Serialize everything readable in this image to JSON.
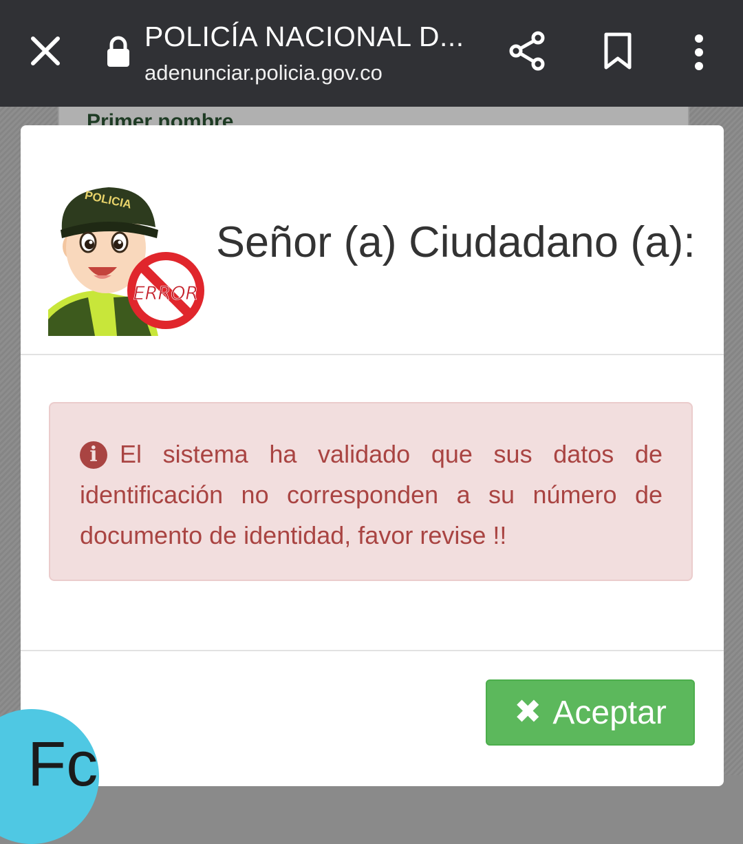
{
  "browser": {
    "title": "POLICÍA NACIONAL D...",
    "url": "adenunciar.policia.gov.co"
  },
  "background_page": {
    "field_label": "Primer nombre"
  },
  "modal": {
    "avatar_cap_text": "POLICIA",
    "avatar_badge_text": "ERROR",
    "title": "Señor (a) Ciudadano (a):",
    "alert_message": "El sistema ha validado que sus datos de identificación no corresponden a su número de documento de identidad, favor revise !!",
    "accept_label": "Aceptar"
  },
  "floating_button": {
    "text": "Fc"
  },
  "icons": [
    "close-icon",
    "lock-icon",
    "share-icon",
    "bookmark-icon",
    "more-vert-icon",
    "info-circle-icon",
    "times-icon"
  ],
  "colors": {
    "toolbar": "#303135",
    "alert_background": "#f2dede",
    "alert_text": "#a94442",
    "accept_button": "#5cb85c",
    "floating_button": "#4fc8e3"
  }
}
